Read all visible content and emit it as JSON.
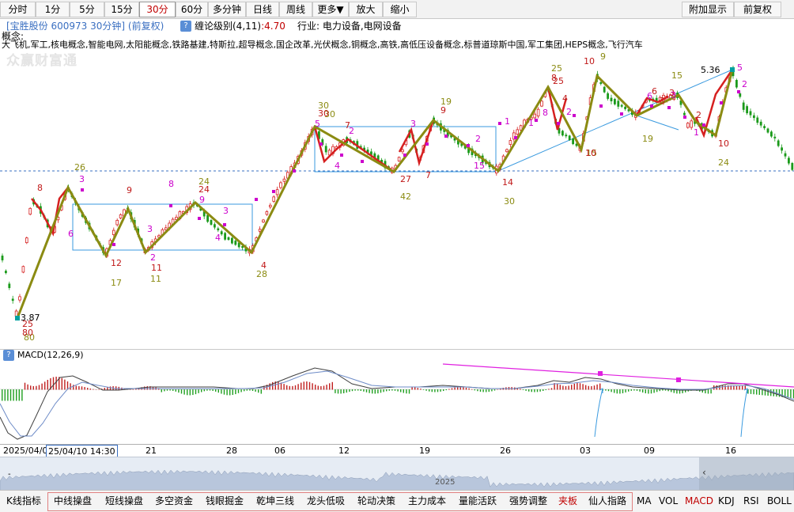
{
  "toolbar": {
    "periods": [
      "分时",
      "1分",
      "5分",
      "15分",
      "30分",
      "60分",
      "多分钟",
      "日线",
      "周线",
      "更多▼",
      "放大",
      "缩小"
    ],
    "active_period": "30分",
    "right": [
      "附加显示",
      "前复权"
    ]
  },
  "info": {
    "stock": "[宝胜股份 600973 30分钟] (前复权)",
    "help": "?",
    "chan_label": "缠论级别(4,11)",
    "chan_value": ":4.70",
    "industry": "行业: 电力设备,电网设备"
  },
  "concept_label": "概念:",
  "concepts": "大飞机,军工,核电概念,智能电网,太阳能概念,铁路基建,特斯拉,超导概念,国企改革,光伏概念,铜概念,高铁,高低压设备概念,标普道琼斯中国,军工集团,HEPS概念,飞行汽车",
  "watermark": "众赢财富通",
  "main_chart": {
    "price_low": "3.87",
    "price_high": "5.36"
  },
  "chart_labels": {
    "olive": [
      "80",
      "17",
      "11",
      "24",
      "28",
      "30",
      "42",
      "19",
      "25",
      "30",
      "15",
      "9",
      "15",
      "19",
      "24",
      "26",
      "30"
    ],
    "red": [
      "25",
      "80",
      "8",
      "9",
      "12",
      "11",
      "24",
      "4",
      "7",
      "27",
      "7",
      "9",
      "4",
      "25",
      "10",
      "14",
      "10",
      "6",
      "10",
      "30",
      "8",
      "3",
      "3",
      "2"
    ],
    "magenta": [
      "3",
      "6",
      "2",
      "3",
      "8",
      "9",
      "5",
      "3",
      "4",
      "2",
      "4",
      "1",
      "3",
      "2",
      "15",
      "1",
      "8",
      "2",
      "5",
      "6",
      "3",
      "2",
      "1"
    ]
  },
  "macd": {
    "help": "?",
    "label": "MACD(12,26,9)"
  },
  "axis": {
    "first": "2025/04/0",
    "current": "25/04/10 14:30",
    "ticks": [
      "21",
      "28",
      "06",
      "12",
      "19",
      "26",
      "03",
      "09",
      "16"
    ]
  },
  "navigator": {
    "year": "2025",
    "handle": "-",
    "arrow": "‹"
  },
  "tabs": {
    "first": "K线指标",
    "items": [
      "中线操盘",
      "短线操盘",
      "多空资金",
      "钱眼掘金",
      "乾坤三线",
      "龙头低吸",
      "轮动决策",
      "主力成本",
      "量能活跃",
      "强势调整",
      "夹板",
      "仙人指路"
    ],
    "red_item": "夹板",
    "indicators": [
      "MA",
      "VOL",
      "MACD",
      "KDJ",
      "RSI",
      "BOLL"
    ],
    "red_indicator": "MACD"
  },
  "colors": {
    "olive": "#8b8b12",
    "up": "#d62020",
    "down": "#1a9a1a",
    "magenta": "#cc00cc",
    "blue": "#3a9adf",
    "zone": "#3a9adf"
  }
}
